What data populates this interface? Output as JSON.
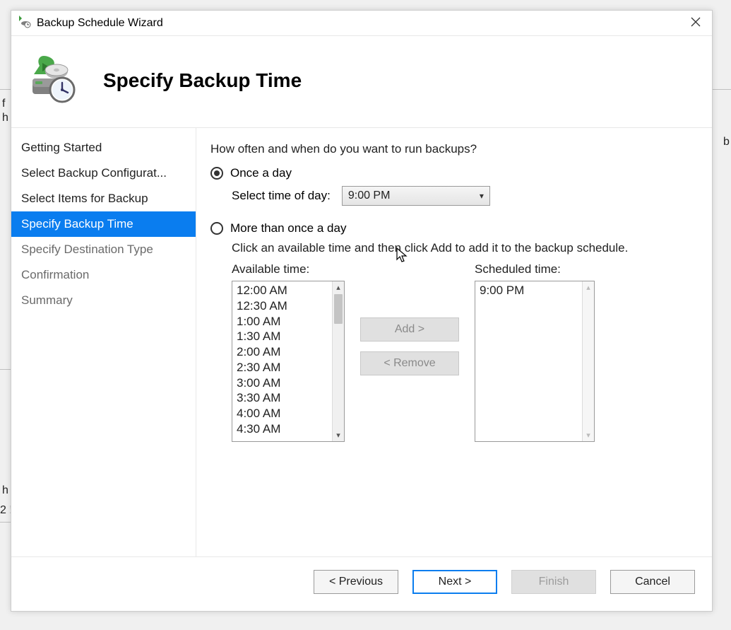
{
  "bg": {
    "l1": "f",
    "l2": "h",
    "l3": "h",
    "l4": "2 !",
    "r1": "b"
  },
  "titlebar": {
    "title": "Backup Schedule Wizard"
  },
  "header": {
    "heading": "Specify Backup Time"
  },
  "sidebar": {
    "items": [
      {
        "label": "Getting Started"
      },
      {
        "label": "Select Backup Configurat..."
      },
      {
        "label": "Select Items for Backup"
      },
      {
        "label": "Specify Backup Time"
      },
      {
        "label": "Specify Destination Type"
      },
      {
        "label": "Confirmation"
      },
      {
        "label": "Summary"
      }
    ]
  },
  "content": {
    "question": "How often and when do you want to run backups?",
    "once_label": "Once a day",
    "timeofday_label": "Select time of day:",
    "timeofday_value": "9:00 PM",
    "more_label": "More than once a day",
    "instruction": "Click an available time and then click Add to add it to the backup schedule.",
    "available_label": "Available time:",
    "scheduled_label": "Scheduled time:",
    "available_times": [
      "12:00 AM",
      "12:30 AM",
      "1:00 AM",
      "1:30 AM",
      "2:00 AM",
      "2:30 AM",
      "3:00 AM",
      "3:30 AM",
      "4:00 AM",
      "4:30 AM"
    ],
    "scheduled_times": [
      "9:00 PM"
    ],
    "add_label": "Add >",
    "remove_label": "< Remove"
  },
  "footer": {
    "previous": "< Previous",
    "next": "Next >",
    "finish": "Finish",
    "cancel": "Cancel"
  }
}
